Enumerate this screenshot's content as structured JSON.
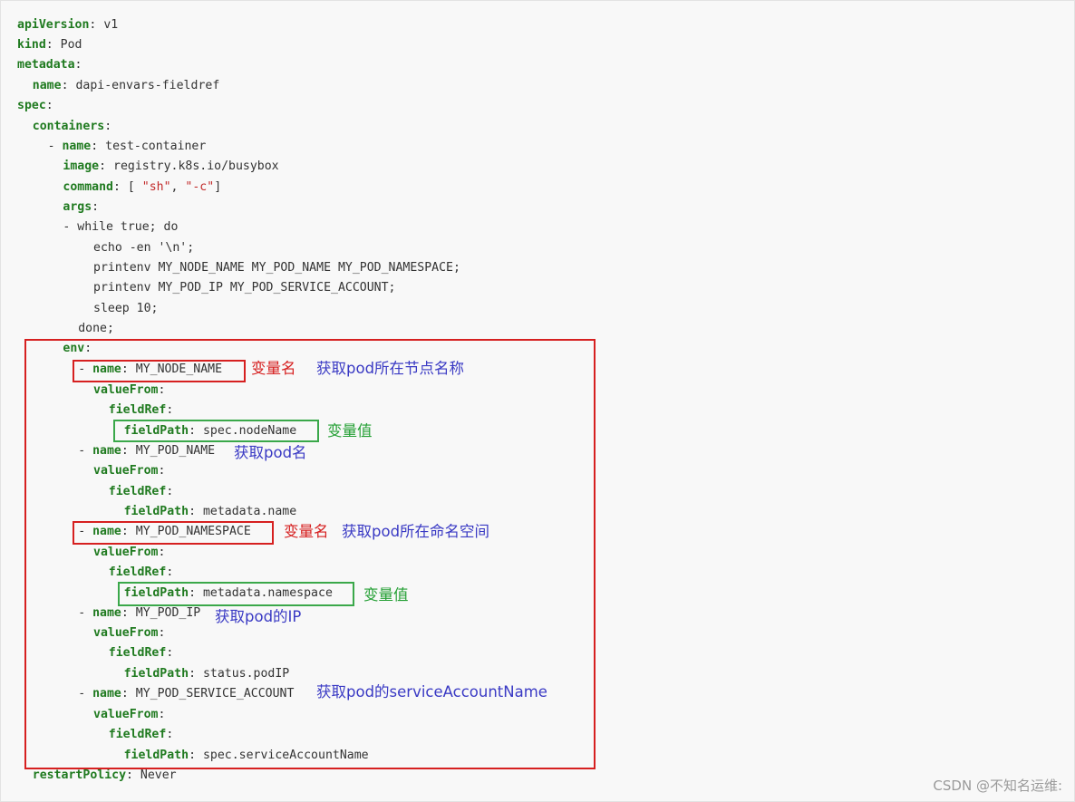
{
  "code_lines": [
    {
      "key": "apiVersion",
      "value": "v1"
    },
    {
      "key": "kind",
      "value": "Pod"
    },
    {
      "key": "metadata",
      "value": ""
    },
    {
      "key": "name",
      "value": "dapi-envars-fieldref"
    },
    {
      "key": "spec",
      "value": ""
    },
    {
      "key": "containers",
      "value": ""
    },
    {
      "prefix": "- ",
      "key": "name",
      "value": "test-container"
    },
    {
      "key": "image",
      "value": "registry.k8s.io/busybox"
    },
    {
      "key": "command",
      "value_parts": [
        "[ ",
        "\"sh\"",
        ", ",
        "\"-c\"",
        "]"
      ]
    },
    {
      "key": "args",
      "value": ""
    },
    {
      "text": "- while true; do"
    },
    {
      "text": "echo -en '\\n';"
    },
    {
      "text": "printenv MY_NODE_NAME MY_POD_NAME MY_POD_NAMESPACE;"
    },
    {
      "text": "printenv MY_POD_IP MY_POD_SERVICE_ACCOUNT;"
    },
    {
      "text": "sleep 10;"
    },
    {
      "text": "done;"
    },
    {
      "key": "env",
      "value": ""
    },
    {
      "prefix": "- ",
      "key": "name",
      "value": "MY_NODE_NAME"
    },
    {
      "key": "valueFrom",
      "value": ""
    },
    {
      "key": "fieldRef",
      "value": ""
    },
    {
      "key": "fieldPath",
      "value": "spec.nodeName"
    },
    {
      "prefix": "- ",
      "key": "name",
      "value": "MY_POD_NAME"
    },
    {
      "key": "valueFrom",
      "value": ""
    },
    {
      "key": "fieldRef",
      "value": ""
    },
    {
      "key": "fieldPath",
      "value": "metadata.name"
    },
    {
      "prefix": "- ",
      "key": "name",
      "value": "MY_POD_NAMESPACE"
    },
    {
      "key": "valueFrom",
      "value": ""
    },
    {
      "key": "fieldRef",
      "value": ""
    },
    {
      "key": "fieldPath",
      "value": "metadata.namespace"
    },
    {
      "prefix": "- ",
      "key": "name",
      "value": "MY_POD_IP"
    },
    {
      "key": "valueFrom",
      "value": ""
    },
    {
      "key": "fieldRef",
      "value": ""
    },
    {
      "key": "fieldPath",
      "value": "status.podIP"
    },
    {
      "prefix": "- ",
      "key": "name",
      "value": "MY_POD_SERVICE_ACCOUNT"
    },
    {
      "key": "valueFrom",
      "value": ""
    },
    {
      "key": "fieldRef",
      "value": ""
    },
    {
      "key": "fieldPath",
      "value": "spec.serviceAccountName"
    },
    {
      "key": "restartPolicy",
      "value": "Never"
    }
  ],
  "annotations": {
    "node_name_var": "变量名",
    "node_name_desc": "获取pod所在节点名称",
    "node_name_val": "变量值",
    "pod_name_desc": "获取pod名",
    "namespace_var": "变量名",
    "namespace_desc": "获取pod所在命名空间",
    "namespace_val": "变量值",
    "pod_ip_desc": "获取pod的IP",
    "service_account_desc": "获取pod的serviceAccountName"
  },
  "watermark": "CSDN @不知名运维:",
  "colors": {
    "key": "#1f7a1f",
    "string": "#c22b2b",
    "annotation_red": "#d62020",
    "annotation_blue": "#3a3ac4",
    "annotation_green": "#25a035"
  }
}
